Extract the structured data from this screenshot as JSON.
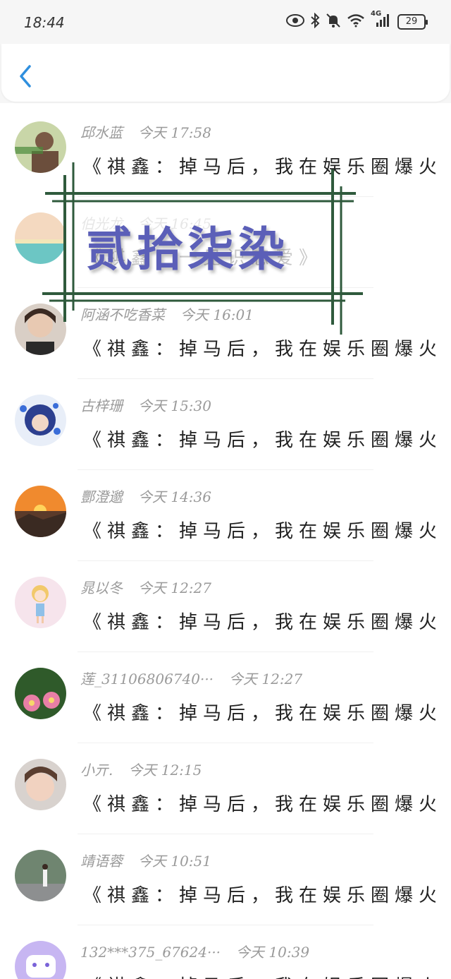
{
  "status_bar": {
    "time": "18:44",
    "battery": "29",
    "network": "4G",
    "icons": [
      "eye-icon",
      "bluetooth-icon",
      "mute-icon",
      "wifi-icon",
      "signal-icon",
      "battery-icon"
    ]
  },
  "nav": {
    "back_icon": "chevron-left-icon",
    "accent": "#2f8fde"
  },
  "watermark": {
    "text": "贰拾柒染",
    "color": "#5b5fb8",
    "frame_color": "#2f5a3c"
  },
  "messages": [
    {
      "name": "邱水蓝",
      "date": "今天",
      "time": "17:58",
      "text": "《祺鑫：掉马后，我在娱乐圈爆火···"
    },
    {
      "name": "伯光龙",
      "date": "今天",
      "time": "16:45",
      "text": "《祺鑫：一见识恋爱》"
    },
    {
      "name": "阿涵不吃香菜",
      "date": "今天",
      "time": "16:01",
      "text": "《祺鑫：掉马后，我在娱乐圈爆火···"
    },
    {
      "name": "古梓珊",
      "date": "今天",
      "time": "15:30",
      "text": "《祺鑫：掉马后，我在娱乐圈爆火···"
    },
    {
      "name": "酆澄邈",
      "date": "今天",
      "time": "14:36",
      "text": "《祺鑫：掉马后，我在娱乐圈爆火···"
    },
    {
      "name": "晁以冬",
      "date": "今天",
      "time": "12:27",
      "text": "《祺鑫：掉马后，我在娱乐圈爆火···"
    },
    {
      "name": "莲_31106806740···",
      "date": "今天",
      "time": "12:27",
      "text": "《祺鑫：掉马后，我在娱乐圈爆火···"
    },
    {
      "name": "小亓.",
      "date": "今天",
      "time": "12:15",
      "text": "《祺鑫：掉马后，我在娱乐圈爆火···"
    },
    {
      "name": "靖语蓉",
      "date": "今天",
      "time": "10:51",
      "text": "《祺鑫：掉马后，我在娱乐圈爆火···"
    },
    {
      "name": "132***375_67624···",
      "date": "今天",
      "time": "10:39",
      "text": "《祺鑫：掉马后，我在娱乐圈爆火···"
    }
  ]
}
